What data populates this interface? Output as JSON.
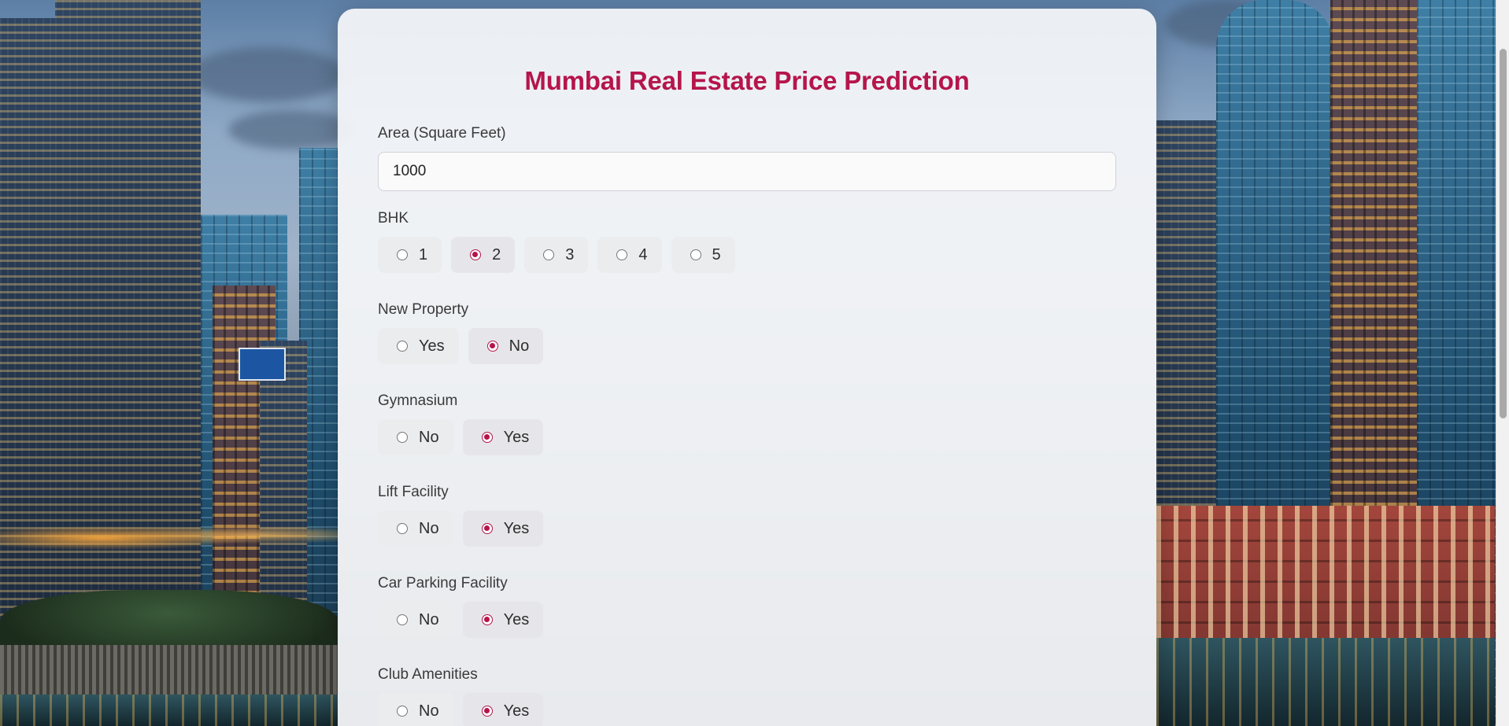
{
  "page": {
    "title": "Mumbai Real Estate Price Prediction",
    "accent_color": "#b5154b"
  },
  "area": {
    "label": "Area (Square Feet)",
    "value": "1000"
  },
  "groups": [
    {
      "key": "bhk",
      "label": "BHK",
      "options": [
        "1",
        "2",
        "3",
        "4",
        "5"
      ],
      "selected": "2"
    },
    {
      "key": "new_property",
      "label": "New Property",
      "options": [
        "Yes",
        "No"
      ],
      "selected": "No"
    },
    {
      "key": "gymnasium",
      "label": "Gymnasium",
      "options": [
        "No",
        "Yes"
      ],
      "selected": "Yes"
    },
    {
      "key": "lift_facility",
      "label": "Lift Facility",
      "options": [
        "No",
        "Yes"
      ],
      "selected": "Yes"
    },
    {
      "key": "car_parking",
      "label": "Car Parking Facility",
      "options": [
        "No",
        "Yes"
      ],
      "selected": "Yes"
    },
    {
      "key": "club_amenities",
      "label": "Club Amenities",
      "options": [
        "No",
        "Yes"
      ],
      "selected": "Yes"
    }
  ],
  "icons": {
    "radio_unchecked": "radio-unchecked-icon",
    "radio_checked": "radio-checked-icon"
  }
}
